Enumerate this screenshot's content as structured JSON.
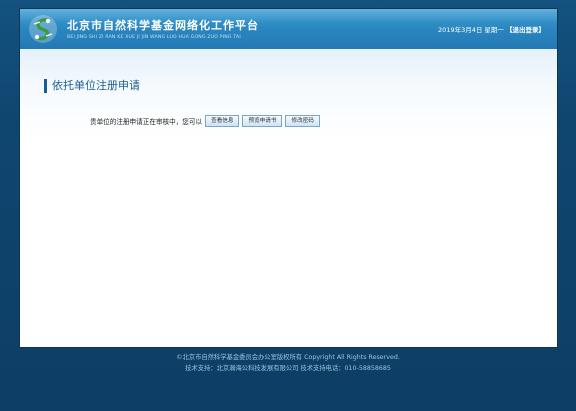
{
  "header": {
    "title": "北京市自然科学基金网络化工作平台",
    "subtitle": "BEI JING SHI ZI RAN KE XUE JI JIN WANG LUO HUA GONG ZUO PING TAI",
    "date_text": "2019年3月4日 星期一",
    "logout_label": "【退出登录】",
    "logo_icon": "science-foundation-logo-icon"
  },
  "main": {
    "section_title": "依托单位注册申请",
    "status_text": "贵单位的注册申请正在审核中，您可以",
    "buttons": {
      "view_info": "查看信息",
      "preview_application": "预览申请书",
      "change_password": "修改密码"
    }
  },
  "footer": {
    "copyright": "©北京市自然科学基金委员会办公室版权所有 Copyright All Rights Reserved.",
    "support": "技术支持：北京瀚海公科技发展有限公司 技术支持电话：010-58858685"
  },
  "colors": {
    "background": "#0f3d63",
    "header_blue": "#2a86c0",
    "title_blue": "#1b5d92",
    "logo_green": "#3a9a3c"
  }
}
